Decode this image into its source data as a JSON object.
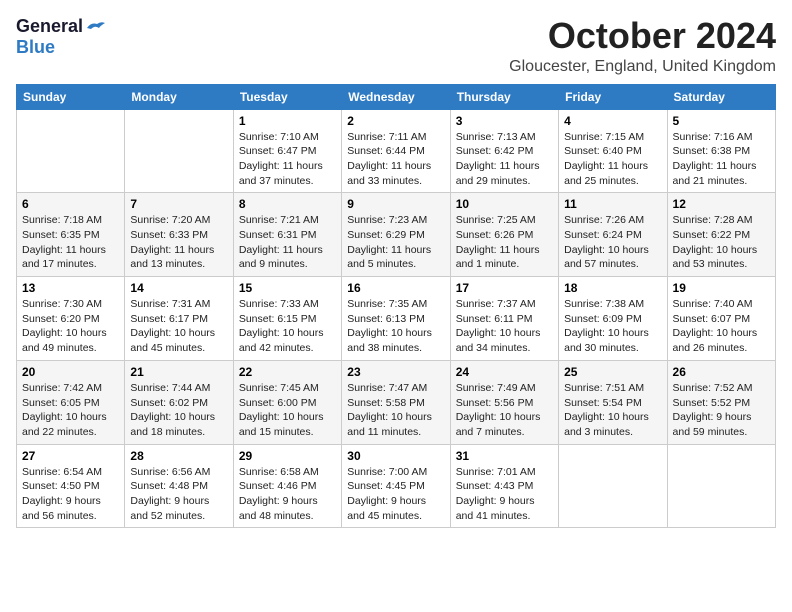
{
  "header": {
    "logo_general": "General",
    "logo_blue": "Blue",
    "month_title": "October 2024",
    "location": "Gloucester, England, United Kingdom"
  },
  "weekdays": [
    "Sunday",
    "Monday",
    "Tuesday",
    "Wednesday",
    "Thursday",
    "Friday",
    "Saturday"
  ],
  "weeks": [
    [
      {
        "day": "",
        "info": ""
      },
      {
        "day": "",
        "info": ""
      },
      {
        "day": "1",
        "info": "Sunrise: 7:10 AM\nSunset: 6:47 PM\nDaylight: 11 hours and 37 minutes."
      },
      {
        "day": "2",
        "info": "Sunrise: 7:11 AM\nSunset: 6:44 PM\nDaylight: 11 hours and 33 minutes."
      },
      {
        "day": "3",
        "info": "Sunrise: 7:13 AM\nSunset: 6:42 PM\nDaylight: 11 hours and 29 minutes."
      },
      {
        "day": "4",
        "info": "Sunrise: 7:15 AM\nSunset: 6:40 PM\nDaylight: 11 hours and 25 minutes."
      },
      {
        "day": "5",
        "info": "Sunrise: 7:16 AM\nSunset: 6:38 PM\nDaylight: 11 hours and 21 minutes."
      }
    ],
    [
      {
        "day": "6",
        "info": "Sunrise: 7:18 AM\nSunset: 6:35 PM\nDaylight: 11 hours and 17 minutes."
      },
      {
        "day": "7",
        "info": "Sunrise: 7:20 AM\nSunset: 6:33 PM\nDaylight: 11 hours and 13 minutes."
      },
      {
        "day": "8",
        "info": "Sunrise: 7:21 AM\nSunset: 6:31 PM\nDaylight: 11 hours and 9 minutes."
      },
      {
        "day": "9",
        "info": "Sunrise: 7:23 AM\nSunset: 6:29 PM\nDaylight: 11 hours and 5 minutes."
      },
      {
        "day": "10",
        "info": "Sunrise: 7:25 AM\nSunset: 6:26 PM\nDaylight: 11 hours and 1 minute."
      },
      {
        "day": "11",
        "info": "Sunrise: 7:26 AM\nSunset: 6:24 PM\nDaylight: 10 hours and 57 minutes."
      },
      {
        "day": "12",
        "info": "Sunrise: 7:28 AM\nSunset: 6:22 PM\nDaylight: 10 hours and 53 minutes."
      }
    ],
    [
      {
        "day": "13",
        "info": "Sunrise: 7:30 AM\nSunset: 6:20 PM\nDaylight: 10 hours and 49 minutes."
      },
      {
        "day": "14",
        "info": "Sunrise: 7:31 AM\nSunset: 6:17 PM\nDaylight: 10 hours and 45 minutes."
      },
      {
        "day": "15",
        "info": "Sunrise: 7:33 AM\nSunset: 6:15 PM\nDaylight: 10 hours and 42 minutes."
      },
      {
        "day": "16",
        "info": "Sunrise: 7:35 AM\nSunset: 6:13 PM\nDaylight: 10 hours and 38 minutes."
      },
      {
        "day": "17",
        "info": "Sunrise: 7:37 AM\nSunset: 6:11 PM\nDaylight: 10 hours and 34 minutes."
      },
      {
        "day": "18",
        "info": "Sunrise: 7:38 AM\nSunset: 6:09 PM\nDaylight: 10 hours and 30 minutes."
      },
      {
        "day": "19",
        "info": "Sunrise: 7:40 AM\nSunset: 6:07 PM\nDaylight: 10 hours and 26 minutes."
      }
    ],
    [
      {
        "day": "20",
        "info": "Sunrise: 7:42 AM\nSunset: 6:05 PM\nDaylight: 10 hours and 22 minutes."
      },
      {
        "day": "21",
        "info": "Sunrise: 7:44 AM\nSunset: 6:02 PM\nDaylight: 10 hours and 18 minutes."
      },
      {
        "day": "22",
        "info": "Sunrise: 7:45 AM\nSunset: 6:00 PM\nDaylight: 10 hours and 15 minutes."
      },
      {
        "day": "23",
        "info": "Sunrise: 7:47 AM\nSunset: 5:58 PM\nDaylight: 10 hours and 11 minutes."
      },
      {
        "day": "24",
        "info": "Sunrise: 7:49 AM\nSunset: 5:56 PM\nDaylight: 10 hours and 7 minutes."
      },
      {
        "day": "25",
        "info": "Sunrise: 7:51 AM\nSunset: 5:54 PM\nDaylight: 10 hours and 3 minutes."
      },
      {
        "day": "26",
        "info": "Sunrise: 7:52 AM\nSunset: 5:52 PM\nDaylight: 9 hours and 59 minutes."
      }
    ],
    [
      {
        "day": "27",
        "info": "Sunrise: 6:54 AM\nSunset: 4:50 PM\nDaylight: 9 hours and 56 minutes."
      },
      {
        "day": "28",
        "info": "Sunrise: 6:56 AM\nSunset: 4:48 PM\nDaylight: 9 hours and 52 minutes."
      },
      {
        "day": "29",
        "info": "Sunrise: 6:58 AM\nSunset: 4:46 PM\nDaylight: 9 hours and 48 minutes."
      },
      {
        "day": "30",
        "info": "Sunrise: 7:00 AM\nSunset: 4:45 PM\nDaylight: 9 hours and 45 minutes."
      },
      {
        "day": "31",
        "info": "Sunrise: 7:01 AM\nSunset: 4:43 PM\nDaylight: 9 hours and 41 minutes."
      },
      {
        "day": "",
        "info": ""
      },
      {
        "day": "",
        "info": ""
      }
    ]
  ]
}
